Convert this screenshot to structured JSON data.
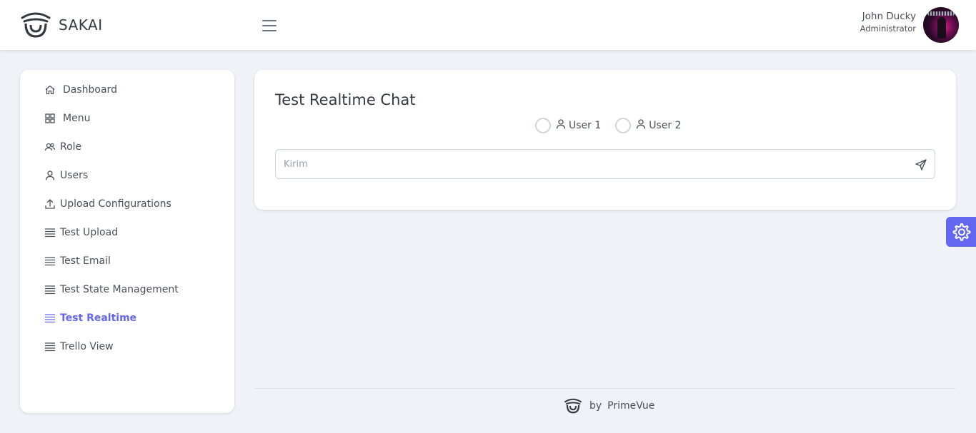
{
  "topbar": {
    "app_name": "SAKAI",
    "user_name": "John Ducky",
    "user_role": "Administrator"
  },
  "sidebar": {
    "items": [
      {
        "label": "Dashboard",
        "icon": "home-icon",
        "active": false
      },
      {
        "label": "Menu",
        "icon": "th-large-icon",
        "active": false
      },
      {
        "label": "Role",
        "icon": "users-icon",
        "active": false
      },
      {
        "label": "Users",
        "icon": "user-icon",
        "active": false
      },
      {
        "label": "Upload Configurations",
        "icon": "upload-icon",
        "active": false
      },
      {
        "label": "Test Upload",
        "icon": "list-icon",
        "active": false
      },
      {
        "label": "Test Email",
        "icon": "list-icon",
        "active": false
      },
      {
        "label": "Test State Management",
        "icon": "list-icon",
        "active": false
      },
      {
        "label": "Test Realtime",
        "icon": "list-icon",
        "active": true
      },
      {
        "label": "Trello View",
        "icon": "list-icon",
        "active": false
      }
    ]
  },
  "main": {
    "title": "Test Realtime Chat",
    "radio_options": [
      {
        "label": "User 1",
        "icon": "user-icon",
        "selected": false
      },
      {
        "label": "User 2",
        "icon": "user-icon",
        "selected": false
      }
    ],
    "message_input": {
      "placeholder": "Kirim",
      "value": ""
    },
    "send_icon": "send-icon"
  },
  "footer": {
    "by": "by",
    "brand": "PrimeVue"
  },
  "colors": {
    "accent": "#6366f1",
    "background": "#eff3f8",
    "surface": "#ffffff",
    "text": "#495057"
  }
}
